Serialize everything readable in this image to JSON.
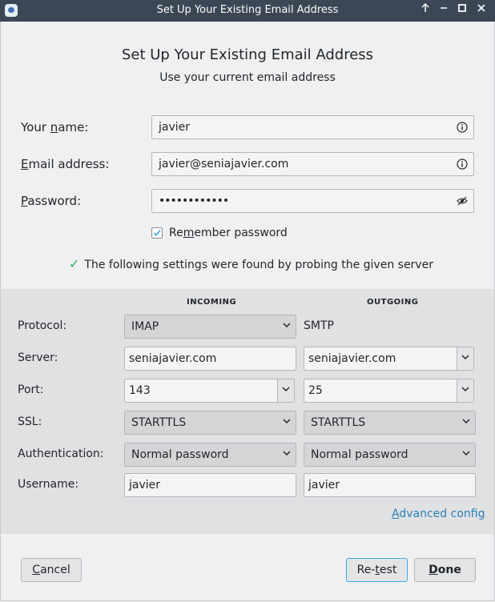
{
  "titlebar": {
    "title": "Set Up Your Existing Email Address",
    "buttons": [
      "keep-above-icon",
      "minimize-icon",
      "maximize-icon",
      "close-icon"
    ]
  },
  "header": {
    "title": "Set Up Your Existing Email Address",
    "subtitle": "Use your current email address"
  },
  "form": {
    "name_label_pre": "Your ",
    "name_label_u": "n",
    "name_label_post": "ame:",
    "name_value": "javier",
    "email_label_u": "E",
    "email_label_post": "mail address:",
    "email_value": "javier@seniajavier.com",
    "password_label_u": "P",
    "password_label_post": "assword:",
    "password_value": "••••••••••••",
    "remember_pre": "Re",
    "remember_u": "m",
    "remember_post": "ember password",
    "remember_checked": true,
    "found_text": "The following settings were found by probing the given server"
  },
  "settings": {
    "incoming_header": "INCOMING",
    "outgoing_header": "OUTGOING",
    "protocol_label": "Protocol:",
    "server_label": "Server:",
    "port_label": "Port:",
    "ssl_label": "SSL:",
    "auth_label": "Authentication:",
    "username_label": "Username:",
    "incoming": {
      "protocol": "IMAP",
      "server": "seniajavier.com",
      "port": "143",
      "ssl": "STARTTLS",
      "auth": "Normal password",
      "username": "javier"
    },
    "outgoing": {
      "protocol": "SMTP",
      "server": "seniajavier.com",
      "port": "25",
      "ssl": "STARTTLS",
      "auth": "Normal password",
      "username": "javier"
    },
    "advanced_u": "A",
    "advanced_post": "dvanced config"
  },
  "buttons": {
    "cancel_pre": "",
    "cancel_u": "C",
    "cancel_post": "ancel",
    "retest_pre": "Re-",
    "retest_u": "t",
    "retest_post": "est",
    "done_u": "D",
    "done_post": "one"
  },
  "colors": {
    "titlebar": "#3c4755",
    "accent": "#3daee9",
    "link": "#2980b9",
    "success": "#27ae60"
  }
}
